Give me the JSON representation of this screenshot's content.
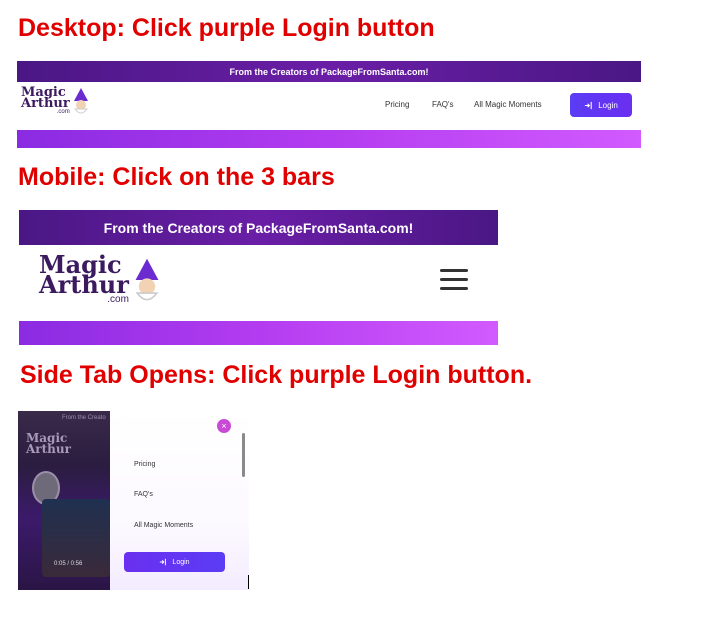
{
  "headings": {
    "desktop": "Desktop: Click purple Login button",
    "mobile": "Mobile: Click on the 3 bars",
    "side": "Side Tab Opens: Click purple Login button."
  },
  "banner_text": "From the Creators of PackageFromSanta.com!",
  "side_banner_text": "From the Creato",
  "logo": {
    "line1": "Magic",
    "line2": "Arthur",
    "line3": ".com"
  },
  "desktop_nav": {
    "links": [
      "Pricing",
      "FAQ's",
      "All Magic Moments"
    ],
    "login_label": "Login"
  },
  "side_menu": {
    "items": [
      "Pricing",
      "FAQ's",
      "All Magic Moments"
    ],
    "login_label": "Login",
    "close_label": "×",
    "video_time": "0:05 / 0:56"
  },
  "icons": {
    "hamburger": "hamburger-menu-icon",
    "login": "login-arrow-icon",
    "close": "close-icon"
  },
  "colors": {
    "heading": "#e00000",
    "banner": "#5a1a96",
    "accent_bar": "#b43cf0",
    "login_button": "#5b3cf5"
  }
}
